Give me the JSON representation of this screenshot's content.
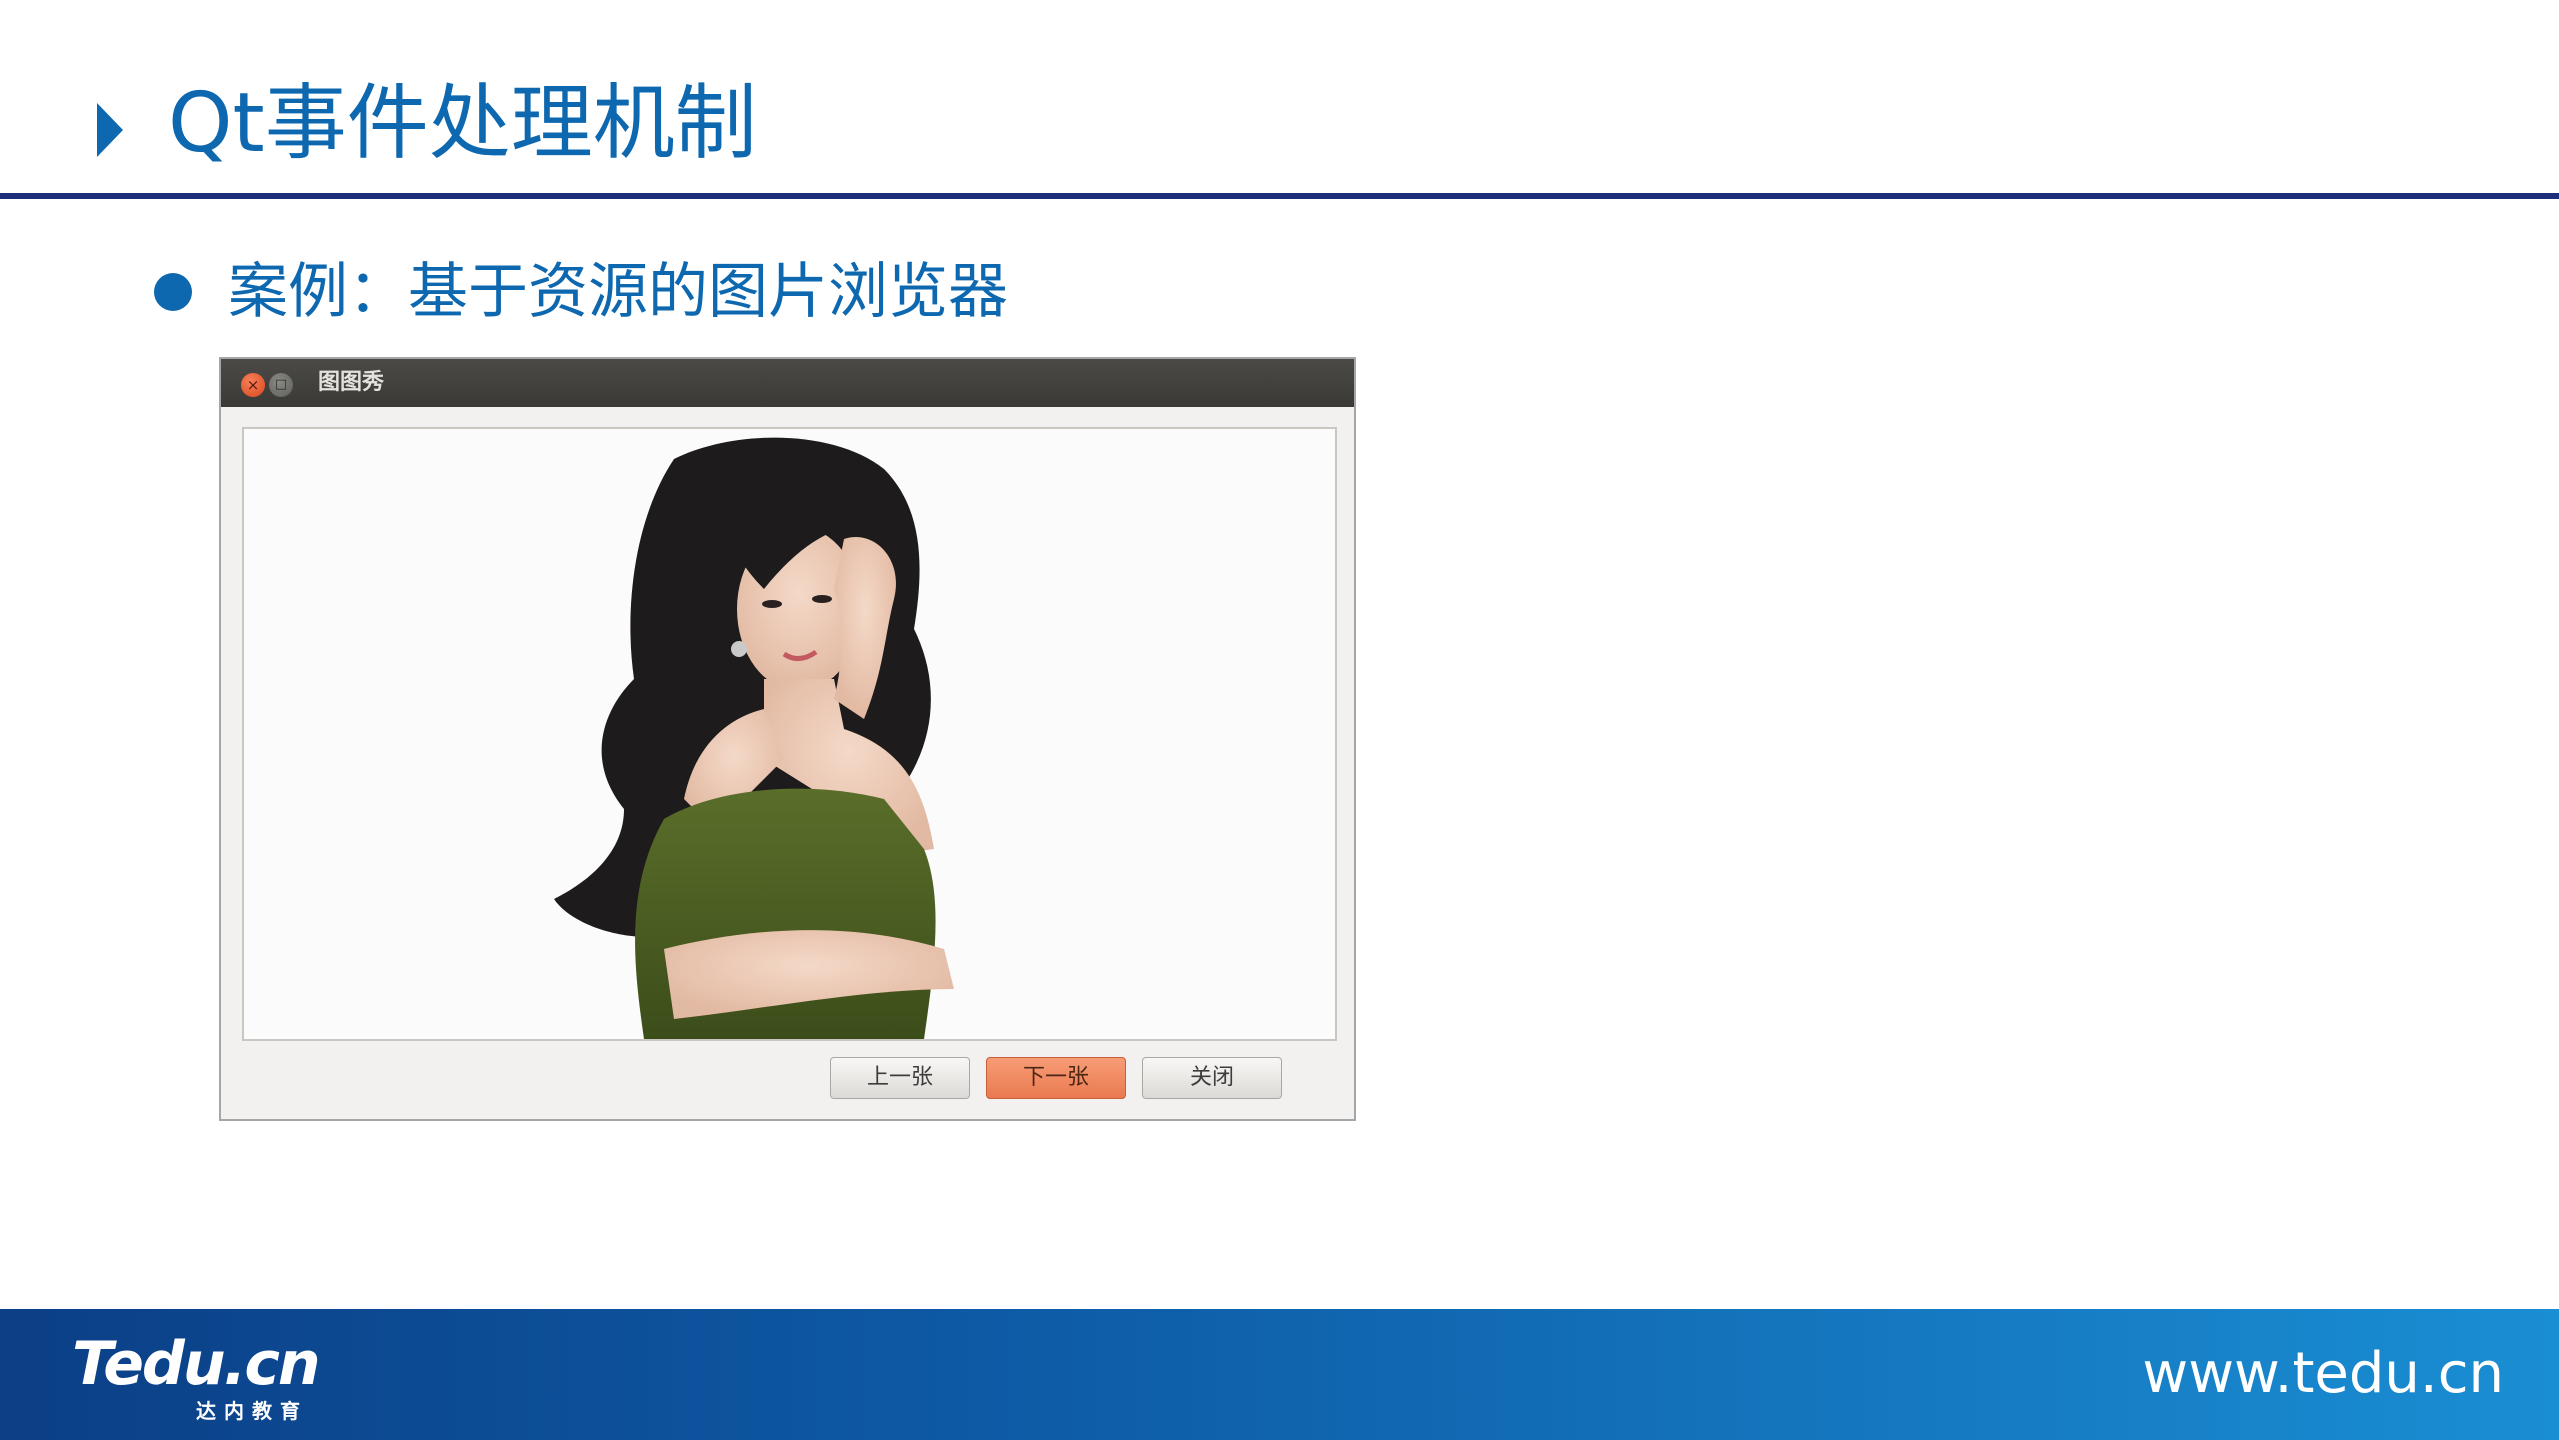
{
  "slide": {
    "title": "Qt事件处理机制",
    "bullet": "案例：基于资源的图片浏览器"
  },
  "window": {
    "title": "图图秀",
    "close_glyph": "×",
    "maximize_glyph": "□",
    "buttons": {
      "prev": "上一张",
      "next": "下一张",
      "close": "关闭"
    }
  },
  "footer": {
    "logo": "Tedu.cn",
    "logo_sub": "达内教育",
    "url": "www.tedu.cn"
  },
  "colors": {
    "accent": "#0d68b0",
    "rule": "#1c2f78",
    "active_button": "#ea7a50"
  }
}
